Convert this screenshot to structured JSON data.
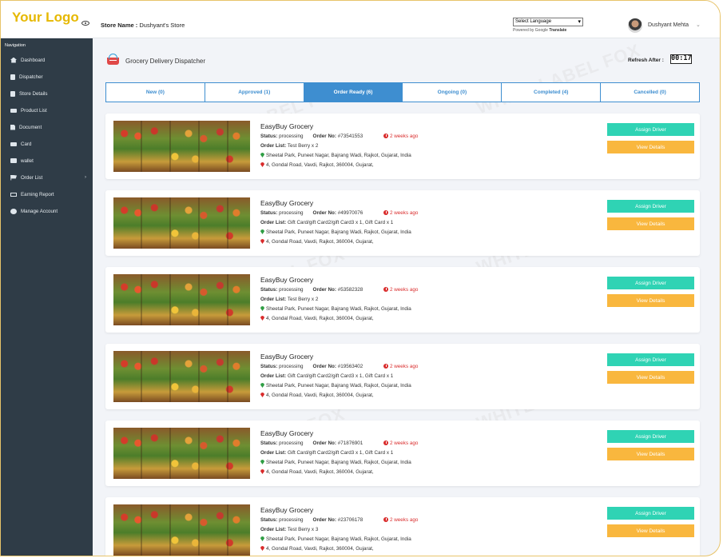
{
  "header": {
    "logo": "Your Logo",
    "store_label": "Store Name :",
    "store_name": "Dushyant's Store",
    "language_select": "Select Language",
    "powered_prefix": "Powered by",
    "powered_google": "Google",
    "powered_translate": "Translate",
    "user_name": "Dushyant Mehta"
  },
  "sidebar": {
    "title": "Navigation",
    "items": [
      {
        "label": "Dashboard",
        "icon": "house-icon"
      },
      {
        "label": "Dispatcher",
        "icon": "clipboard-icon"
      },
      {
        "label": "Store Details",
        "icon": "store-icon"
      },
      {
        "label": "Product List",
        "icon": "list-icon"
      },
      {
        "label": "Document",
        "icon": "document-icon"
      },
      {
        "label": "Card",
        "icon": "card-icon"
      },
      {
        "label": "wallet",
        "icon": "wallet-icon"
      },
      {
        "label": "Order List",
        "icon": "cart-icon"
      },
      {
        "label": "Earning Report",
        "icon": "money-icon"
      },
      {
        "label": "Manage Account",
        "icon": "gear-icon"
      }
    ]
  },
  "page": {
    "title": "Grocery Delivery Dispatcher",
    "refresh_label": "Refresh After :",
    "refresh_timer": "00:17"
  },
  "tabs": [
    {
      "label": "New (0)",
      "active": false
    },
    {
      "label": "Approved (1)",
      "active": false
    },
    {
      "label": "Order Ready (6)",
      "active": true
    },
    {
      "label": "Ongoing (0)",
      "active": false
    },
    {
      "label": "Completed (4)",
      "active": false
    },
    {
      "label": "Cancelled (0)",
      "active": false
    }
  ],
  "labels": {
    "status": "Status:",
    "order_no": "Order No:",
    "order_list": "Order List:",
    "assign_driver": "Assign Driver",
    "view_details": "View Details"
  },
  "orders": [
    {
      "store": "EasyBuy Grocery",
      "status": "processing",
      "order_no": "#73541553",
      "ago": "2 weeks ago",
      "items": "Test Berry x 2",
      "pickup": "Sheetal Park, Puneet Nagar, Bajrang Wadi, Rajkot, Gujarat, India",
      "dropoff": "4, Gondal Road, Vavdi, Rajkot, 360004, Gujarat,"
    },
    {
      "store": "EasyBuy Grocery",
      "status": "processing",
      "order_no": "#49970076",
      "ago": "2 weeks ago",
      "items": "Gift Card/gift Card2/gift Card3 x 1, Gift Card x 1",
      "pickup": "Sheetal Park, Puneet Nagar, Bajrang Wadi, Rajkot, Gujarat, India",
      "dropoff": "4, Gondal Road, Vavdi, Rajkot, 360004, Gujarat,"
    },
    {
      "store": "EasyBuy Grocery",
      "status": "processing",
      "order_no": "#53582328",
      "ago": "2 weeks ago",
      "items": "Test Berry x 2",
      "pickup": "Sheetal Park, Puneet Nagar, Bajrang Wadi, Rajkot, Gujarat, India",
      "dropoff": "4, Gondal Road, Vavdi, Rajkot, 360004, Gujarat,"
    },
    {
      "store": "EasyBuy Grocery",
      "status": "processing",
      "order_no": "#19563402",
      "ago": "2 weeks ago",
      "items": "Gift Card/gift Card2/gift Card3 x 1, Gift Card x 1",
      "pickup": "Sheetal Park, Puneet Nagar, Bajrang Wadi, Rajkot, Gujarat, India",
      "dropoff": "4, Gondal Road, Vavdi, Rajkot, 360004, Gujarat,"
    },
    {
      "store": "EasyBuy Grocery",
      "status": "processing",
      "order_no": "#71876901",
      "ago": "2 weeks ago",
      "items": "Gift Card/gift Card2/gift Card3 x 1, Gift Card x 1",
      "pickup": "Sheetal Park, Puneet Nagar, Bajrang Wadi, Rajkot, Gujarat, India",
      "dropoff": "4, Gondal Road, Vavdi, Rajkot, 360004, Gujarat,"
    },
    {
      "store": "EasyBuy Grocery",
      "status": "processing",
      "order_no": "#23706178",
      "ago": "2 weeks ago",
      "items": "Test Berry x 3",
      "pickup": "Sheetal Park, Puneet Nagar, Bajrang Wadi, Rajkot, Gujarat, India",
      "dropoff": "4, Gondal Road, Vavdi, Rajkot, 360004, Gujarat,"
    }
  ],
  "watermark": "WHITE LABEL FOX",
  "colors": {
    "logo": "#e6b800",
    "sidebar": "#2f3c47",
    "tab_accent": "#3e8ed0",
    "assign_button": "#2fd3b4",
    "view_button": "#f9b73e",
    "time_ago": "#d92b2b"
  }
}
